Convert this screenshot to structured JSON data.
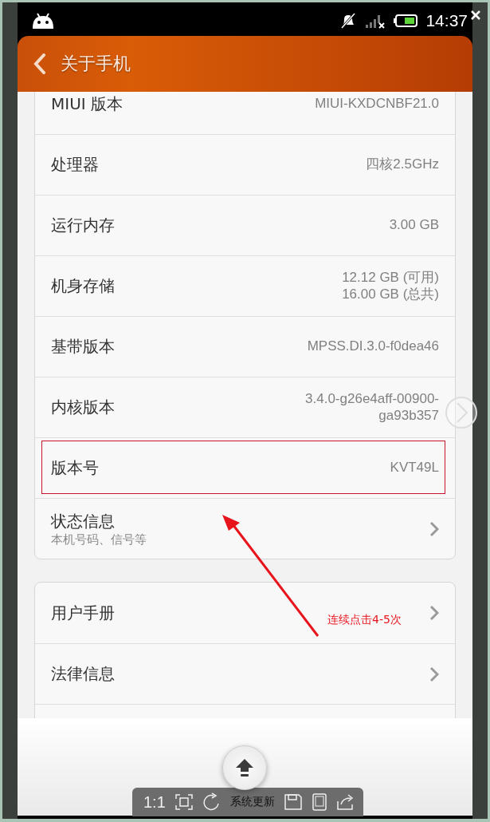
{
  "status_bar": {
    "time": "14:37"
  },
  "header": {
    "title": "关于手机"
  },
  "sections": [
    {
      "rows": [
        {
          "kind": "info",
          "label": "MIUI 版本",
          "values": [
            "MIUI-KXDCNBF21.0"
          ],
          "highlighted": false
        },
        {
          "kind": "info",
          "label": "处理器",
          "values": [
            "四核2.5GHz"
          ],
          "highlighted": false
        },
        {
          "kind": "info",
          "label": "运行内存",
          "values": [
            "3.00 GB"
          ],
          "highlighted": false
        },
        {
          "kind": "info",
          "label": "机身存储",
          "values": [
            "12.12 GB (可用)",
            "16.00 GB (总共)"
          ],
          "highlighted": false
        },
        {
          "kind": "info",
          "label": "基带版本",
          "values": [
            "MPSS.DI.3.0-f0dea46"
          ],
          "highlighted": false
        },
        {
          "kind": "info",
          "label": "内核版本",
          "values": [
            "3.4.0-g26e4aff-00900-",
            "ga93b357"
          ],
          "highlighted": false
        },
        {
          "kind": "info",
          "label": "版本号",
          "values": [
            "KVT49L"
          ],
          "highlighted": true
        },
        {
          "kind": "link",
          "label": "状态信息",
          "subtitle": "本机号码、信号等"
        }
      ]
    },
    {
      "rows": [
        {
          "kind": "link",
          "label": "用户手册"
        },
        {
          "kind": "link",
          "label": "法律信息"
        },
        {
          "kind": "blank"
        }
      ]
    }
  ],
  "covered_text": "系统更新",
  "toolbar": {
    "zoom_label": "1:1"
  },
  "annotation": {
    "text": "连续点击4-5次"
  }
}
